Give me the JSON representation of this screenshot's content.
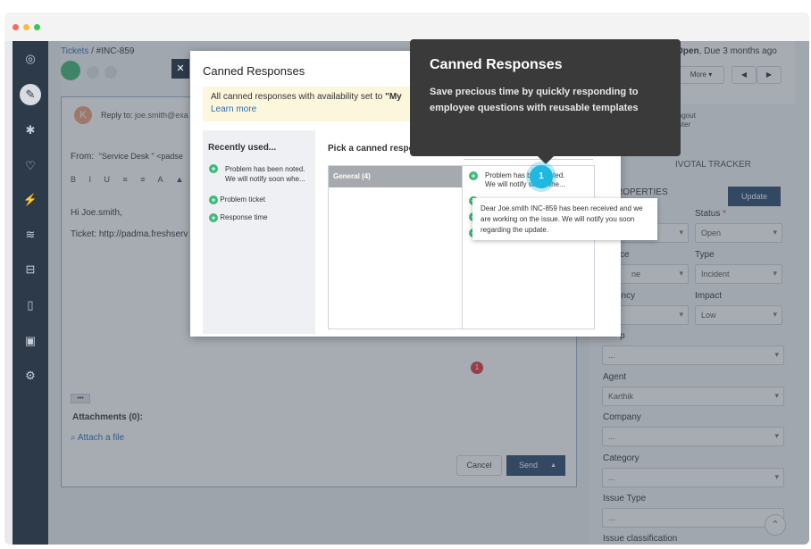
{
  "breadcrumb": {
    "parent": "Tickets",
    "sep": " / ",
    "id": "#INC-859"
  },
  "header": {
    "status": "Open",
    "due": ", Due 3 months ago",
    "more": "More ▾"
  },
  "reply": {
    "to_label": "Reply to:",
    "to_value": "joe.smith@exa",
    "avatar": "K",
    "from_label": "From:",
    "from_value": "\"Service Desk \" <padse",
    "greeting": "Hi Joe.smith,",
    "ticket_line": "Ticket: http://padma.freshserv",
    "more_btn": "•••",
    "attachments": "Attachments (0):",
    "attach_link": "Attach a file",
    "cancel": "Cancel",
    "send": "Send",
    "badge_count": "1"
  },
  "right_panel": {
    "hangout_line1": "e Hangout",
    "hangout_line2": "equester",
    "tracker": "IVOTAL TRACKER",
    "properties": "ROPERTIES",
    "update": "Update",
    "status_label": "Status",
    "required": "*",
    "status_value": "Open",
    "source_label": "ce",
    "source_value": "ne",
    "type_label": "Type",
    "type_value": "Incident",
    "urgency_label": "ency",
    "impact_label": "Impact",
    "impact_value": "Low",
    "group_label": "p",
    "group_value": "...",
    "agent_label": "Agent",
    "agent_value": "Karthik",
    "company_label": "Company",
    "company_value": "...",
    "category_label": "Category",
    "category_value": "...",
    "issue_type_label": "Issue Type",
    "issue_type_value": "...",
    "issue_class_label": "Issue classification"
  },
  "modal": {
    "title": "Canned Responses",
    "close": "✕",
    "notice_prefix": "All canned responses with availability set to ",
    "notice_bold": "\"My",
    "learn_more": "Learn more",
    "recent_heading": "Recently used...",
    "recent_items": [
      {
        "line1": "Problem has been noted.",
        "line2": "We will notify soon whe..."
      },
      {
        "line1": "Problem ticket",
        "line2": ""
      },
      {
        "line1": "Response time",
        "line2": ""
      }
    ],
    "pick_heading": "Pick a canned response",
    "search_placeholder": "Search",
    "folder": "General (4)",
    "list_item_line1": "Problem has been noted.",
    "list_item_line2": "We will notify soon whe...",
    "preview": "Dear Joe.smith      INC-859 has been received and we are working on the issue. We will notify you soon regarding the update."
  },
  "tooltip": {
    "title": "Canned Responses",
    "body": "Save precious time by quickly responding to employee questions with reusable templates",
    "step": "1"
  },
  "colors": {
    "sidebar": "#2c3a4a",
    "accent_blue": "#2a4a6e",
    "tip_bg": "#3a3a3a",
    "step_badge": "#1eb8e0",
    "alert_red": "#e0393e",
    "green": "#3cb878"
  }
}
